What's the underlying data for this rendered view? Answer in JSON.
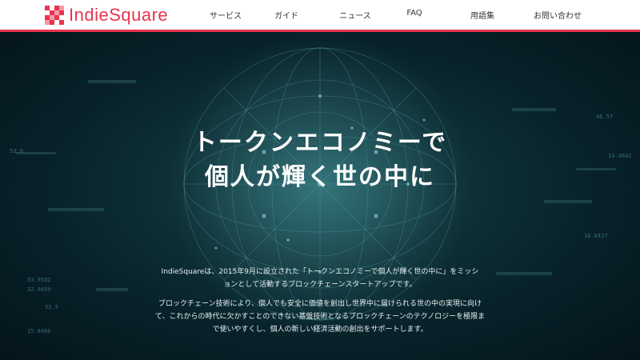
{
  "header": {
    "logo_text": "IndieSquare",
    "nav": [
      {
        "label": "サービス",
        "name": "nav-services"
      },
      {
        "label": "ガイド",
        "name": "nav-guide"
      },
      {
        "label": "ニュース",
        "name": "nav-news"
      },
      {
        "label": "FAQ",
        "name": "nav-faq"
      },
      {
        "label": "用語集",
        "name": "nav-glossary"
      },
      {
        "label": "お問い合わせ",
        "name": "nav-contact"
      }
    ]
  },
  "hero": {
    "headline_line1": "トークンエコノミーで",
    "headline_line2": "個人が輝く世の中に",
    "paragraph1_line1": "IndieSquareは、2015年9月に設立された「トークンエコノミーで個人が輝く世の中に」をミッシ",
    "paragraph1_line2": "ョンとして活動するブロックチェーンスタートアップです。",
    "paragraph2_line1": "ブロックチェーン技術により、個人でも安全に価値を創出し世界中に届けられる世の中の実現に向け",
    "paragraph2_line2": "て、これからの時代に欠かすことのできない基盤技術となるブロックチェーンのテクノロジーを極限ま",
    "paragraph2_line3": "で使いやすくし、個人の新しい経済活動の創出をサポートします。",
    "background_numbers": [
      "53.9582",
      "32.9459",
      "53.5",
      "15.8466",
      "46.57",
      "14.4842",
      "10.8417",
      "53.9"
    ]
  },
  "colors": {
    "brand_red": "#e8344e",
    "header_bg": "#ffffff",
    "hero_bg": "#061a1e",
    "hero_glow": "#1d4f56"
  },
  "icons": {
    "logo_mark": "pixel-checker-logo-icon"
  }
}
